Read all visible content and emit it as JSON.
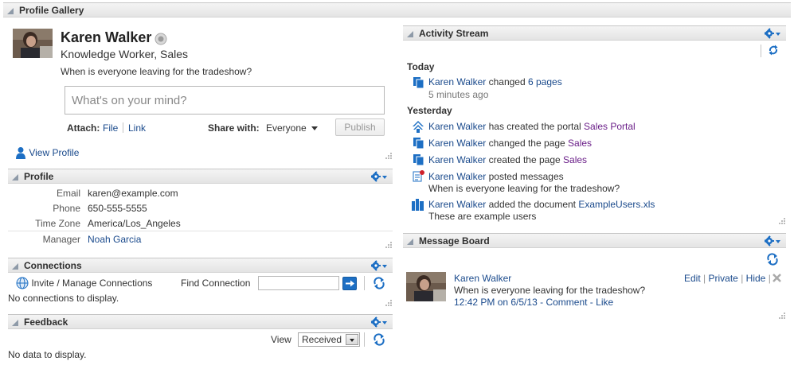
{
  "gallery": {
    "title": "Profile Gallery"
  },
  "profile_card": {
    "name": "Karen Walker",
    "role": "Knowledge Worker, Sales",
    "status_message": "When is everyone leaving for the tradeshow?",
    "post_placeholder": "What's on your mind?",
    "attach_label": "Attach:",
    "attach_file": "File",
    "attach_link": "Link",
    "share_label": "Share with:",
    "share_value": "Everyone",
    "publish_label": "Publish",
    "view_profile": "View Profile"
  },
  "profile_section": {
    "title": "Profile",
    "rows": [
      {
        "label": "Email",
        "value": "karen@example.com"
      },
      {
        "label": "Phone",
        "value": "650-555-5555"
      },
      {
        "label": "Time Zone",
        "value": "America/Los_Angeles"
      },
      {
        "label": "Manager",
        "value": "Noah Garcia"
      }
    ]
  },
  "connections": {
    "title": "Connections",
    "invite_label": "Invite / Manage Connections",
    "find_label": "Find Connection",
    "find_value": "",
    "empty": "No connections to display."
  },
  "feedback": {
    "title": "Feedback",
    "view_label": "View",
    "view_value": "Received",
    "empty": "No data to display."
  },
  "activity": {
    "title": "Activity Stream",
    "today_label": "Today",
    "yesterday_label": "Yesterday",
    "today": {
      "actor": "Karen Walker",
      "verb": "changed",
      "object": "6 pages",
      "time": "5 minutes ago"
    },
    "yesterday": [
      {
        "actor": "Karen Walker",
        "text": "has created the portal",
        "object": "Sales Portal",
        "icon": "portal-icon"
      },
      {
        "actor": "Karen Walker",
        "text": "changed the page",
        "object": "Sales",
        "icon": "pages-icon"
      },
      {
        "actor": "Karen Walker",
        "text": "created the page",
        "object": "Sales",
        "icon": "pages-icon"
      },
      {
        "actor": "Karen Walker",
        "text": "posted messages",
        "object": "",
        "detail": "When is everyone leaving for the tradeshow?",
        "icon": "message-icon"
      },
      {
        "actor": "Karen Walker",
        "text": "added the document",
        "object": "ExampleUsers.xls",
        "detail": "These are example users",
        "icon": "document-icon"
      }
    ]
  },
  "message_board": {
    "title": "Message Board",
    "author": "Karen Walker",
    "message": "When is everyone leaving for the tradeshow?",
    "timestamp": "12:42 PM on 6/5/13",
    "separator": "-",
    "comment": "Comment",
    "like": "Like",
    "edit": "Edit",
    "private": "Private",
    "hide": "Hide"
  },
  "colors": {
    "link": "#1a4a8c",
    "accent_purple": "#6a1e88",
    "icon_blue": "#1d6fc4",
    "header_bg": "#e8e8e8"
  }
}
